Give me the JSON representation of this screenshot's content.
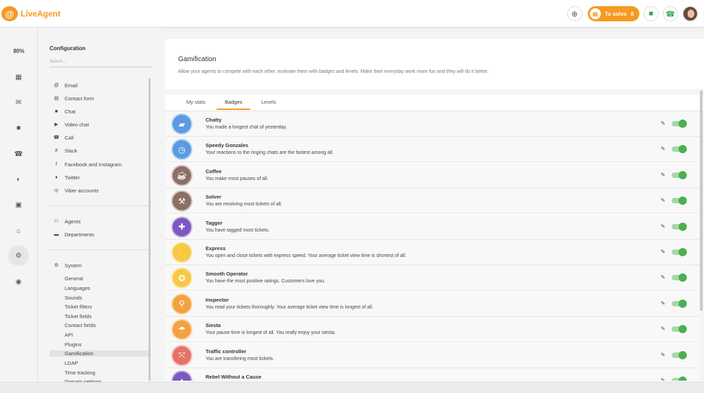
{
  "app": {
    "logo_text": "LiveAgent",
    "logo_symbol": "@"
  },
  "header": {
    "to_solve_label": "To solve",
    "to_solve_count": "8",
    "icons": [
      "plus-circle-icon",
      "chat-icon",
      "phone-icon"
    ]
  },
  "rail": {
    "percent": "80%",
    "items": [
      "dashboard-icon",
      "mail-icon",
      "chat-icon",
      "phone-icon",
      "reports-icon",
      "contacts-icon",
      "knowledgebase-icon",
      "settings-icon",
      "plugins-icon"
    ]
  },
  "config": {
    "title": "Configuration",
    "search_placeholder": "Search ...",
    "channels": [
      {
        "icon": "@",
        "label": "Email"
      },
      {
        "icon": "▤",
        "label": "Contact form"
      },
      {
        "icon": "■",
        "label": "Chat"
      },
      {
        "icon": "▶",
        "label": "Video chat"
      },
      {
        "icon": "☎",
        "label": "Call"
      },
      {
        "icon": "#",
        "label": "Slack"
      },
      {
        "icon": "f",
        "label": "Facebook and Instagram"
      },
      {
        "icon": "♦",
        "label": "Twitter"
      },
      {
        "icon": "◎",
        "label": "Viber accounts"
      }
    ],
    "team": [
      {
        "icon": "⚇",
        "label": "Agents"
      },
      {
        "icon": "▬",
        "label": "Departments"
      }
    ],
    "system": {
      "icon": "⚙",
      "label": "System"
    },
    "system_items": [
      "General",
      "Languages",
      "Sounds",
      "Ticket filters",
      "Ticket fields",
      "Contact fields",
      "API",
      "Plugins",
      "Gamification",
      "LDAP",
      "Time tracking",
      "Domain settings"
    ],
    "active_item": "Gamification"
  },
  "main": {
    "title": "Gamification",
    "description": "Allow your agents to compete with each other, motivate them with badges and levels. Make their everyday work more fun and they will do it better.",
    "tabs": [
      "My stats",
      "Badges",
      "Levels"
    ],
    "active_tab": "Badges"
  },
  "badges": [
    {
      "name": "Chatty",
      "desc": "You made a longest chat of yesterday.",
      "color": "#5b9be0",
      "glyph": "▰",
      "enabled": true
    },
    {
      "name": "Speedy Gonzales",
      "desc": "Your reactions to the ringing chats are the fastest among all.",
      "color": "#5b9be0",
      "glyph": "◷",
      "enabled": true
    },
    {
      "name": "Coffee",
      "desc": "You make most pauses of all.",
      "color": "#8d6e63",
      "glyph": "☕",
      "enabled": true
    },
    {
      "name": "Solver",
      "desc": "You are resolving most tickets of all.",
      "color": "#8d6e63",
      "glyph": "⚒",
      "enabled": true
    },
    {
      "name": "Tagger",
      "desc": "You have tagged most tickets.",
      "color": "#7e57c2",
      "glyph": "✚",
      "enabled": true
    },
    {
      "name": "Express",
      "desc": "You open and close tickets with express speed. Your average ticket view time is shortest of all.",
      "color": "#f7c948",
      "glyph": "⚡",
      "enabled": true
    },
    {
      "name": "Smooth Operator",
      "desc": "You have the most positive ratings. Customers love you.",
      "color": "#f7c948",
      "glyph": "✪",
      "enabled": true
    },
    {
      "name": "Inspector",
      "desc": "You read your tickets thoroughly. Your average ticket view time is longest of all.",
      "color": "#f5a142",
      "glyph": "⚲",
      "enabled": true
    },
    {
      "name": "Siesta",
      "desc": "Your pause time is longest of all. You really enjoy your siesta.",
      "color": "#f5a142",
      "glyph": "☂",
      "enabled": true
    },
    {
      "name": "Traffic controller",
      "desc": "You are transfering most tickets.",
      "color": "#e57368",
      "glyph": "⤧",
      "enabled": true
    },
    {
      "name": "Rebel Without a Cause",
      "desc": "",
      "color": "#7e57c2",
      "glyph": "✦",
      "enabled": true
    }
  ]
}
